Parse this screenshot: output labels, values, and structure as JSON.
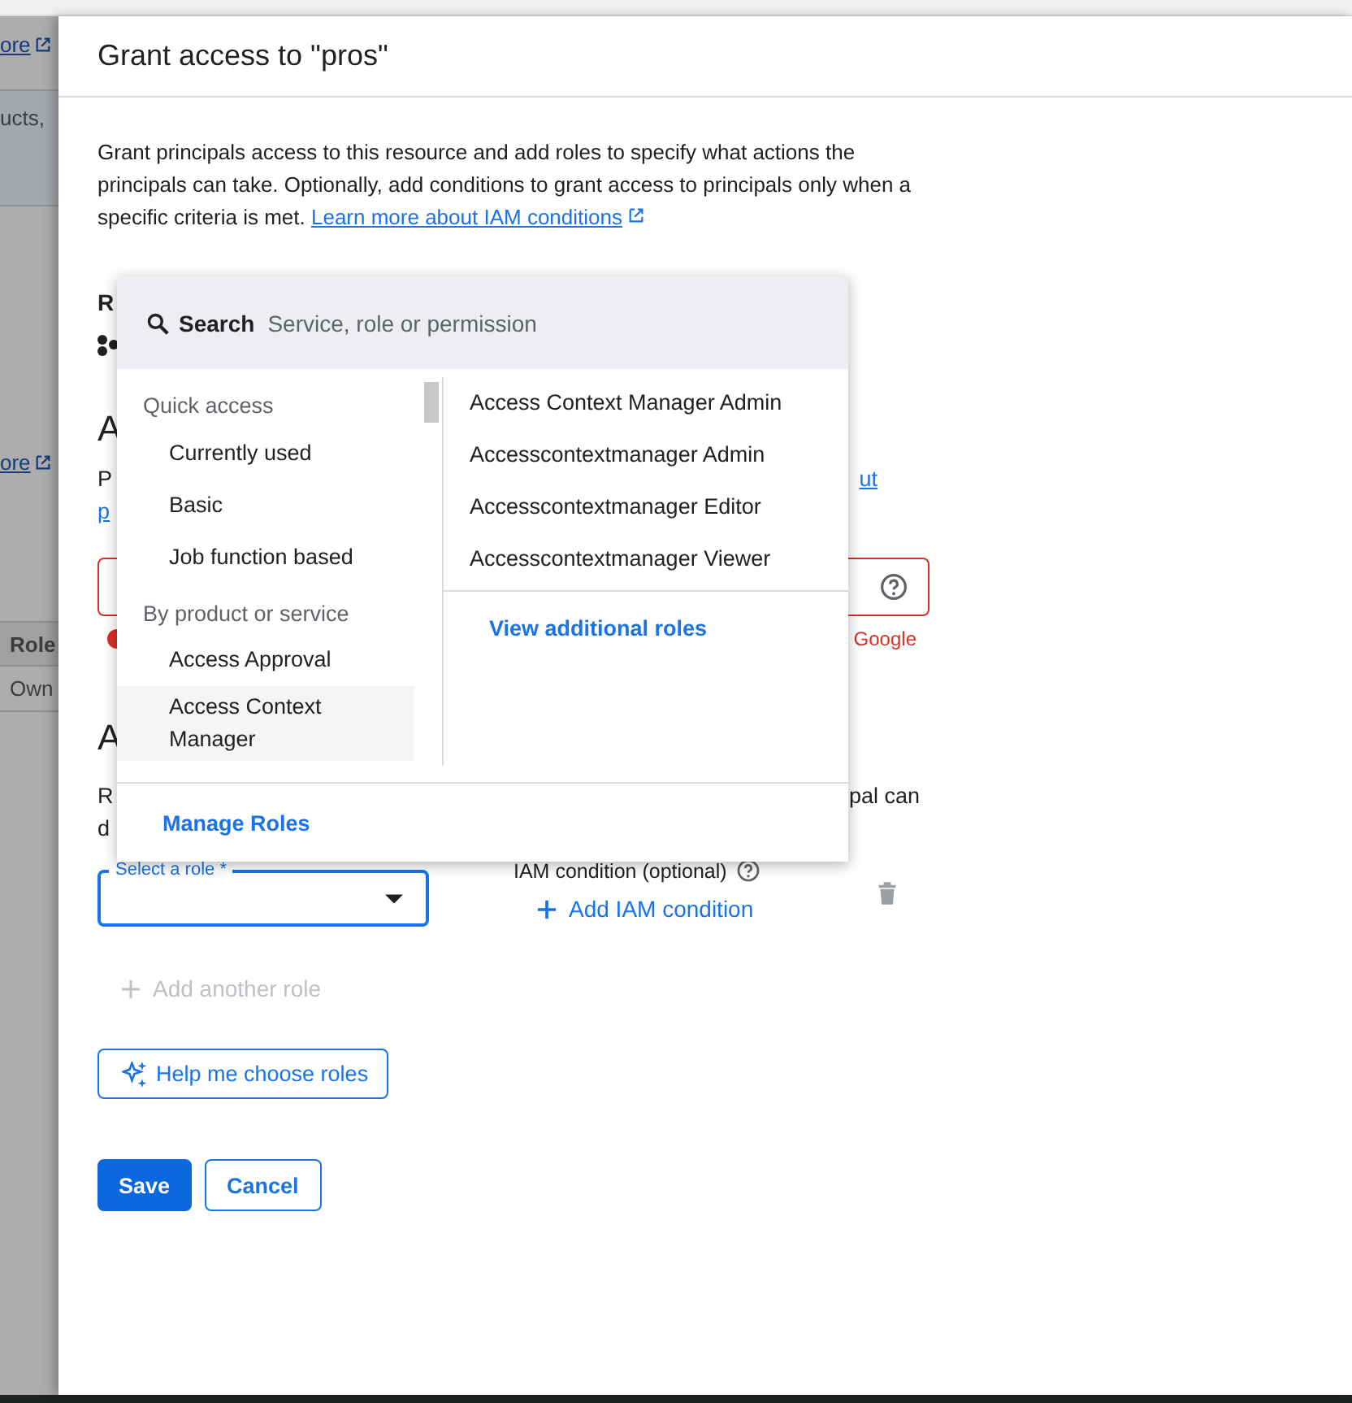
{
  "background_page": {
    "items": [
      {
        "kind": "link",
        "text": "ore"
      },
      {
        "kind": "band",
        "text": "ucts,"
      },
      {
        "kind": "link",
        "text": "ore"
      },
      {
        "kind": "header",
        "text": "Role"
      },
      {
        "kind": "text",
        "text": "Own"
      }
    ]
  },
  "panel": {
    "title": "Grant access to \"pros\"",
    "description": {
      "text": "Grant principals access to this resource and add roles to specify what actions the principals can take. Optionally, add conditions to grant access to principals only when a specific criteria is met. ",
      "link": "Learn more about IAM conditions"
    },
    "partially_hidden": {
      "label_1": "R",
      "heading_1": "A",
      "text_1_start": "P",
      "text_1_link_end": "ut",
      "text_2_link": "p",
      "field_invalid": true,
      "field_error_end": "Google",
      "heading_2": "A",
      "text_3_start": "R",
      "text_3_end": "pal can",
      "text_4_start": "d"
    },
    "role_select": {
      "label": "Select a role *",
      "focused": true
    },
    "condition": {
      "label": "IAM condition (optional)",
      "button": "Add IAM condition"
    },
    "add_role": {
      "label": "Add another role",
      "disabled": true
    },
    "help_button": "Help me choose roles",
    "actions": [
      {
        "label": "Save",
        "kind": "primary"
      },
      {
        "label": "Cancel",
        "kind": "secondary"
      }
    ]
  },
  "role_picker": {
    "search_label": "Search",
    "search_placeholder": "Service, role or permission",
    "categories": [
      {
        "kind": "heading",
        "label": "Quick access"
      },
      {
        "kind": "item",
        "label": "Currently used",
        "selected": false
      },
      {
        "kind": "item",
        "label": "Basic",
        "selected": false
      },
      {
        "kind": "item",
        "label": "Job function based",
        "selected": false
      },
      {
        "kind": "heading",
        "label": "By product or service"
      },
      {
        "kind": "item",
        "label": "Access Approval",
        "selected": false
      },
      {
        "kind": "item",
        "label": "Access Context Manager",
        "selected": true
      }
    ],
    "roles": [
      "Access Context Manager Admin",
      "Accesscontextmanager Admin",
      "Accesscontextmanager Editor",
      "Accesscontextmanager Viewer"
    ],
    "more_link": "View additional roles",
    "footer_link": "Manage Roles"
  }
}
